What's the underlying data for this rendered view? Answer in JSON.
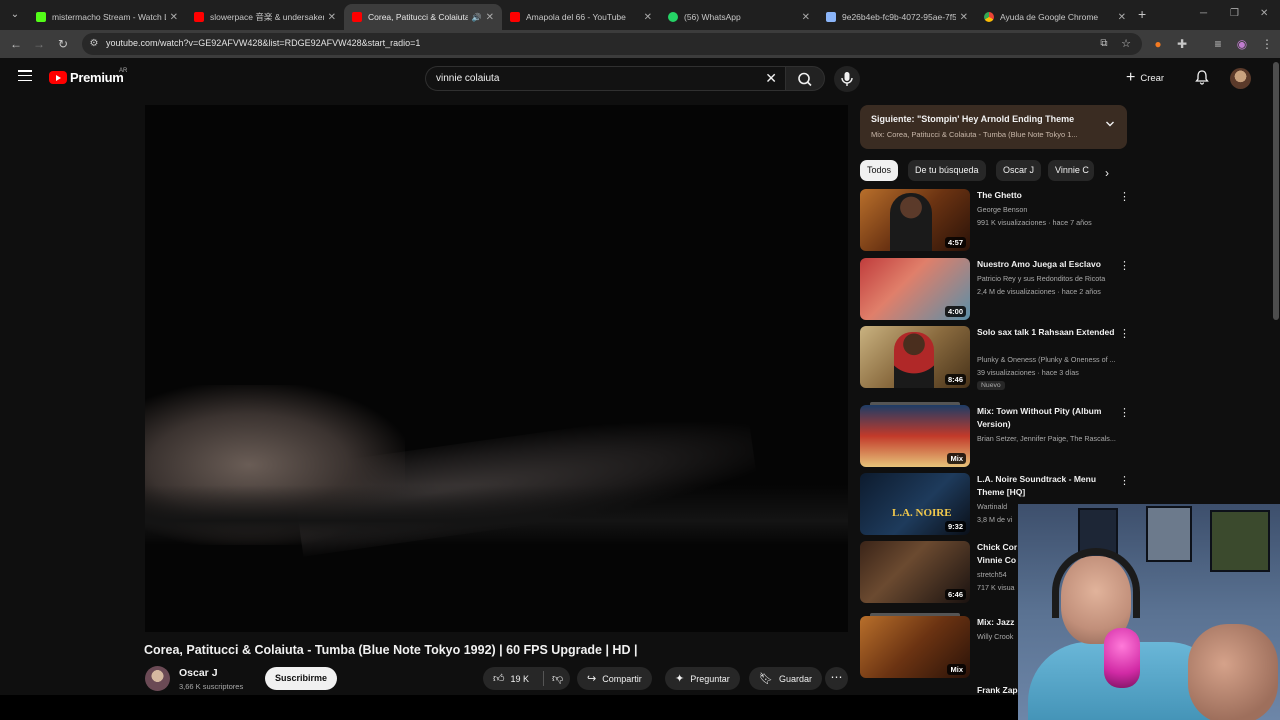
{
  "browser": {
    "tabs": [
      {
        "title": "mistermacho Stream - Watch Li...",
        "favicon_color": "#53fc18"
      },
      {
        "title": "slowerpace 音楽 & undersaken...",
        "favicon_color": "#ff0000"
      },
      {
        "title": "Corea, Patitucci & Colaiuta",
        "favicon_color": "#ff0000",
        "active": true
      },
      {
        "title": "Amapola del 66 - YouTube",
        "favicon_color": "#ff0000"
      },
      {
        "title": "(56) WhatsApp",
        "favicon_color": "#25d366"
      },
      {
        "title": "9e26b4eb-fc9b-4072-95ae-7f5...",
        "favicon_color": "#8ab4f8"
      },
      {
        "title": "Ayuda de Google Chrome",
        "favicon_color": "#4285f4"
      }
    ],
    "url": "youtube.com/watch?v=GE92AFVW428&list=RDGE92AFVW428&start_radio=1"
  },
  "header": {
    "logo_text": "Premium",
    "region": "AR",
    "search_value": "vinnie colaiuta",
    "create_label": "Crear"
  },
  "video": {
    "title": "Corea, Patitucci & Colaiuta - Tumba (Blue Note Tokyo 1992) | 60 FPS Upgrade | HD |",
    "channel": "Oscar J",
    "subscribers": "3,66 K suscriptores",
    "subscribe_label": "Suscribirme",
    "likes": "19 K",
    "share_label": "Compartir",
    "ask_label": "Preguntar",
    "save_label": "Guardar"
  },
  "mix": {
    "title": "Siguiente: \"Stompin' Hey Arnold Ending Theme",
    "subtitle": "Mix: Corea, Patitucci & Colaiuta - Tumba (Blue Note Tokyo 1..."
  },
  "chips": [
    "Todos",
    "De tu búsqueda",
    "Oscar J",
    "Vinnie C"
  ],
  "recommendations": [
    {
      "title": "The Ghetto",
      "channel": "George Benson",
      "meta": "991 K visualizaciones · hace 7 años",
      "duration": "4:57"
    },
    {
      "title": "Nuestro Amo Juega al Esclavo",
      "channel": "Patricio Rey y sus Redonditos de Ricota",
      "meta": "2,4 M de visualizaciones · hace 2 años",
      "duration": "4:00"
    },
    {
      "title": "Solo sax talk 1 Rahsaan Extended",
      "channel": "Plunky & Oneness (Plunky & Oneness of ...",
      "meta": "39 visualizaciones · hace 3 días",
      "duration": "8:46",
      "badge": "Nuevo"
    },
    {
      "title": "Mix: Town Without Pity (Album Version)",
      "channel": "Brian Setzer, Jennifer Paige, The Rascals...",
      "meta": "",
      "duration": "Mix"
    },
    {
      "title": "L.A. Noire Soundtrack - Menu Theme [HQ]",
      "channel": "Wartinald",
      "meta": "3,8 M de vi",
      "duration": "9:32"
    },
    {
      "title": "Chick Cor Vinnie Co",
      "channel": "stretch54",
      "meta": "717 K visua",
      "duration": "6:46"
    },
    {
      "title": "Mix: Jazz",
      "channel": "Willy Crook",
      "meta": "",
      "duration": "Mix"
    },
    {
      "title": "Frank Zap",
      "channel": "",
      "meta": "",
      "duration": ""
    }
  ],
  "thumb_labels": {
    "ghetto": "",
    "noire": "L.A. NOIRE"
  },
  "colors": {
    "accent": "#ff0000",
    "mix_panel": "#3a2c22"
  }
}
